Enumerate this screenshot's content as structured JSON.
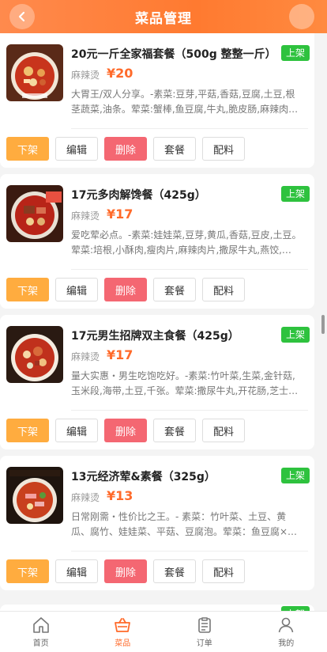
{
  "header": {
    "title": "菜品管理"
  },
  "items": [
    {
      "title": "20元一斤全家福套餐（500g 整整一斤）",
      "status": "上架",
      "category": "麻辣烫",
      "price": "¥20",
      "desc": "大胃王/双人分享。-素菜:豆芽,平菇,香菇,豆腐,土豆,根茎蔬菜,油条。荤菜:蟹棒,鱼豆腐,牛丸,脆皮肠,麻辣肉…"
    },
    {
      "title": "17元多肉解馋餐（425g）",
      "status": "上架",
      "category": "麻辣烫",
      "price": "¥17",
      "desc": "爱吃荤必点。-素菜:娃娃菜,豆芽,黄瓜,香菇,豆皮,土豆。荤菜:培根,小酥肉,瘦肉片,麻辣肉片,撒尿牛丸,燕饺,…"
    },
    {
      "title": "17元男生招牌双主食餐（425g）",
      "status": "上架",
      "category": "麻辣烫",
      "price": "¥17",
      "desc": "量大实惠・男生吃饱吃好。-素菜:竹叶菜,生菜,金针菇,玉米段,海带,土豆,千张。荤菜:撒尿牛丸,开花肠,芝士…"
    },
    {
      "title": "13元经济荤&素餐（325g）",
      "status": "上架",
      "category": "麻辣烫",
      "price": "¥13",
      "desc": "日常刚需・性价比之王。- 素菜：竹叶菜、土豆、黄瓜、腐竹、娃娃菜、平菇、豆腐泡。荤菜：鱼豆腐×…"
    }
  ],
  "actions": {
    "off": "下架",
    "edit": "编辑",
    "delete": "删除",
    "combo": "套餐",
    "ingredients": "配料"
  },
  "peek_status": "上架",
  "tabs": [
    {
      "label": "首页",
      "icon": "home-icon"
    },
    {
      "label": "菜品",
      "icon": "basket-icon",
      "active": true
    },
    {
      "label": "订单",
      "icon": "order-icon"
    },
    {
      "label": "我的",
      "icon": "user-icon"
    }
  ],
  "colors": {
    "header": "#ff7a30",
    "accent": "#ff6a2a",
    "status_on": "#2ec23e",
    "off_button": "#ffac3f",
    "delete_button": "#f46772"
  }
}
